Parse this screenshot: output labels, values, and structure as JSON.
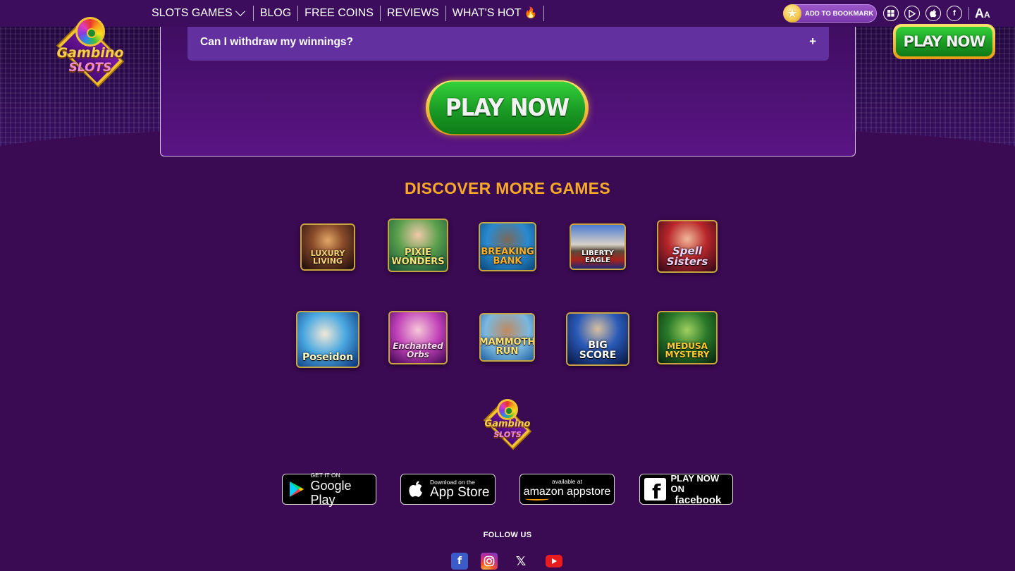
{
  "nav": {
    "items": [
      {
        "label": "SLOTS GAMES",
        "has_dropdown": true
      },
      {
        "label": "BLOG"
      },
      {
        "label": "FREE COINS"
      },
      {
        "label": "REVIEWS"
      },
      {
        "label": "WHAT'S HOT"
      }
    ],
    "hot_icon": "🔥",
    "bookmark_label": "ADD TO BOOKMARK",
    "bookmark_icon": "star-icon",
    "platform_icons": [
      "windows-icon",
      "google-play-icon",
      "apple-icon",
      "facebook-icon"
    ],
    "font_size_label_big": "A",
    "font_size_label_small": "A"
  },
  "logo": {
    "line1": "Gambino",
    "line2": "SLOTS"
  },
  "faq": {
    "question": "Can I withdraw my winnings?",
    "toggle": "+"
  },
  "cta": {
    "play_now": "PLAY NOW",
    "header_play_now": "PLAY NOW"
  },
  "discover": {
    "title": "DISCOVER MORE GAMES",
    "games_row1": [
      {
        "name": "LUXURY LIVING"
      },
      {
        "name": "PIXIE WONDERS"
      },
      {
        "name": "BREAKING BANK"
      },
      {
        "name": "LIBERTY EAGLE"
      },
      {
        "name": "Spell Sisters"
      }
    ],
    "games_row2": [
      {
        "name": "Poseidon"
      },
      {
        "name": "Enchanted Orbs"
      },
      {
        "name": "MAMMOTH RUN"
      },
      {
        "name": "BIG SCORE"
      },
      {
        "name": "MEDUSA MYSTERY"
      }
    ]
  },
  "stores": [
    {
      "small": "GET IT ON",
      "big": "Google Play",
      "icon": "google-play-icon"
    },
    {
      "small": "Download on the",
      "big": "App Store",
      "icon": "apple-icon"
    },
    {
      "small": "available at",
      "big": "amazon appstore",
      "icon": "amazon-icon"
    },
    {
      "small": "PLAY NOW ON",
      "big": "facebook",
      "icon": "facebook-icon"
    }
  ],
  "footer": {
    "follow_us": "FOLLOW US",
    "social": [
      "facebook-icon",
      "instagram-icon",
      "x-icon",
      "youtube-icon"
    ]
  },
  "colors": {
    "background": "#3a0a52",
    "accent_orange": "#f7a927",
    "play_green": "#1a9b24",
    "gold_border": "#f2c230"
  }
}
